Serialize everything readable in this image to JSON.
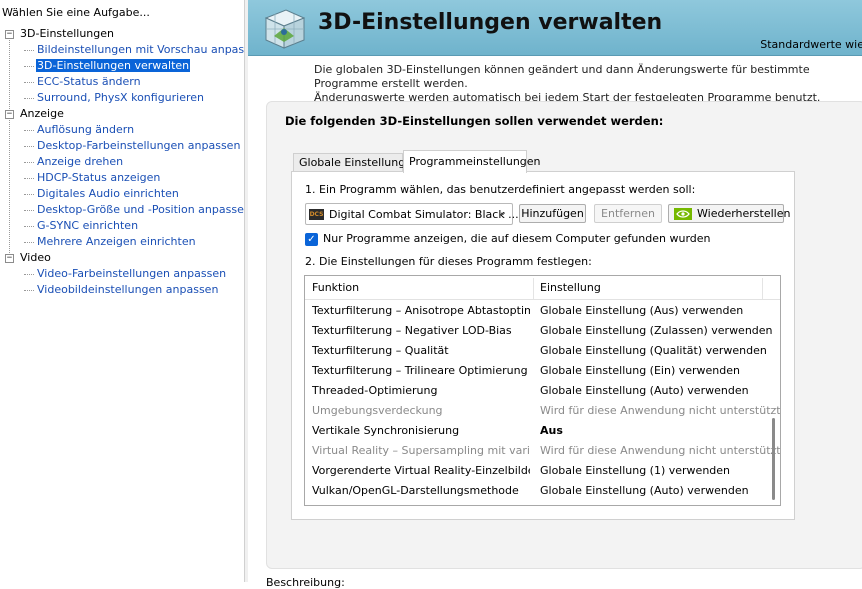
{
  "left_panel": {
    "task_label": "Wählen Sie eine Aufgabe...",
    "tree": [
      {
        "category": "3D-Einstellungen",
        "items": [
          {
            "label": "Bildeinstellungen mit Vorschau anpassen",
            "selected": false
          },
          {
            "label": "3D-Einstellungen verwalten",
            "selected": true
          },
          {
            "label": "ECC-Status ändern",
            "selected": false
          },
          {
            "label": "Surround, PhysX konfigurieren",
            "selected": false
          }
        ]
      },
      {
        "category": "Anzeige",
        "items": [
          {
            "label": "Auflösung ändern",
            "selected": false
          },
          {
            "label": "Desktop-Farbeinstellungen anpassen",
            "selected": false
          },
          {
            "label": "Anzeige drehen",
            "selected": false
          },
          {
            "label": "HDCP-Status anzeigen",
            "selected": false
          },
          {
            "label": "Digitales Audio einrichten",
            "selected": false
          },
          {
            "label": "Desktop-Größe und -Position anpassen",
            "selected": false
          },
          {
            "label": "G-SYNC einrichten",
            "selected": false
          },
          {
            "label": "Mehrere Anzeigen einrichten",
            "selected": false
          }
        ]
      },
      {
        "category": "Video",
        "items": [
          {
            "label": "Video-Farbeinstellungen anpassen",
            "selected": false
          },
          {
            "label": "Videobildeinstellungen anpassen",
            "selected": false
          }
        ]
      }
    ]
  },
  "header": {
    "title": "3D-Einstellungen verwalten",
    "defaults_link": "Standardwerte wie",
    "icon": "3d-cube-icon"
  },
  "intro": {
    "line1": "Die globalen 3D-Einstellungen können geändert und dann Änderungswerte für bestimmte Programme erstellt werden.",
    "line2": "Änderungswerte werden automatisch bei jedem Start der festgelegten Programme benutzt."
  },
  "card": {
    "heading": "Die folgenden 3D-Einstellungen sollen verwendet werden:",
    "tabs": [
      {
        "label": "Globale Einstellungen",
        "active": false
      },
      {
        "label": "Programmeinstellungen",
        "active": true
      }
    ],
    "step1_label": "1. Ein Programm wählen, das benutzerdefiniert angepasst werden soll:",
    "program": {
      "value": "Digital Combat Simulator: Black ...",
      "icon_text": "DCS"
    },
    "buttons": {
      "add": "Hinzufügen",
      "remove": "Entfernen",
      "restore": "Wiederherstellen"
    },
    "checkbox": {
      "label": "Nur Programme anzeigen, die auf diesem Computer gefunden wurden",
      "checked": true
    },
    "step2_label": "2. Die Einstellungen für dieses Programm festlegen:",
    "table": {
      "columns": [
        "Funktion",
        "Einstellung"
      ],
      "rows": [
        {
          "feature": "Texturfilterung – Anisotrope Abtastoptimi...",
          "setting": "Globale Einstellung (Aus) verwenden",
          "state": "normal"
        },
        {
          "feature": "Texturfilterung – Negativer LOD-Bias",
          "setting": "Globale Einstellung (Zulassen) verwenden",
          "state": "normal"
        },
        {
          "feature": "Texturfilterung – Qualität",
          "setting": "Globale Einstellung (Qualität) verwenden",
          "state": "normal"
        },
        {
          "feature": "Texturfilterung – Trilineare Optimierung",
          "setting": "Globale Einstellung (Ein) verwenden",
          "state": "normal"
        },
        {
          "feature": "Threaded-Optimierung",
          "setting": "Globale Einstellung (Auto) verwenden",
          "state": "normal"
        },
        {
          "feature": "Umgebungsverdeckung",
          "setting": "Wird für diese Anwendung nicht unterstützt",
          "state": "disabled"
        },
        {
          "feature": "Vertikale Synchronisierung",
          "setting": "Aus",
          "state": "bold"
        },
        {
          "feature": "Virtual Reality – Supersampling mit variabl...",
          "setting": "Wird für diese Anwendung nicht unterstützt",
          "state": "disabled"
        },
        {
          "feature": "Vorgerenderte Virtual Reality-Einzelbilder",
          "setting": "Globale Einstellung (1) verwenden",
          "state": "normal"
        },
        {
          "feature": "Vulkan/OpenGL-Darstellungsmethode",
          "setting": "Globale Einstellung (Auto) verwenden",
          "state": "normal"
        }
      ]
    }
  },
  "description_label": "Beschreibung:",
  "colors": {
    "selection": "#0a64d8",
    "link": "#1a4fb5",
    "nvidia_green": "#76b900",
    "banner": "#7fbed3"
  }
}
